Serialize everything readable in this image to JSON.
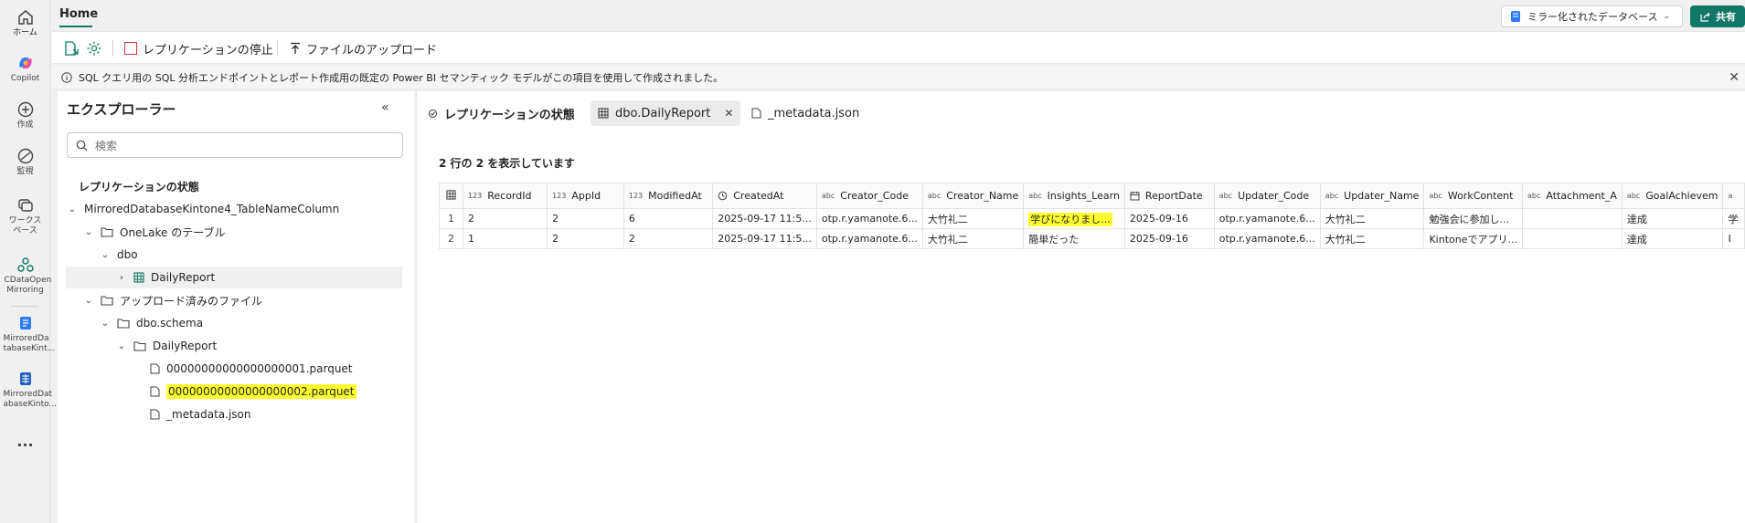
{
  "rail": {
    "items": [
      {
        "label": "ホーム",
        "icon": "home-icon"
      },
      {
        "label": "Copilot",
        "icon": "copilot-icon"
      },
      {
        "label": "作成",
        "icon": "create-icon"
      },
      {
        "label": "監視",
        "icon": "monitor-icon"
      },
      {
        "label": "ワークスペース",
        "icon": "workspaces-icon"
      },
      {
        "label": "CDataOpen Mirroring",
        "icon": "workspace-icon"
      },
      {
        "label": "MirroredDa tabaseKint...",
        "icon": "mirrored-db-icon"
      },
      {
        "label": "MirroredDat abaseKinto...",
        "icon": "sql-endpoint-icon"
      }
    ],
    "more": "..."
  },
  "topbar": {
    "home_tab": "Home",
    "mirror_dropdown": "ミラー化されたデータベース",
    "share": "共有"
  },
  "toolbar": {
    "stop_replication": "レプリケーションの停止",
    "upload_files": "ファイルのアップロード"
  },
  "infobar": {
    "message": "SQL クエリ用の SQL 分析エンドポイントとレポート作成用の既定の Power BI セマンティック モデルがこの項目を使用して作成されました。"
  },
  "explorer": {
    "title": "エクスプローラー",
    "search_placeholder": "検索",
    "tree": {
      "replication_status": "レプリケーションの状態",
      "database": "MirroredDatabaseKintone4_TableNameColumn",
      "onelake_tables": "OneLake のテーブル",
      "dbo": "dbo",
      "daily_report_table": "DailyReport",
      "uploaded_files": "アップロード済みのファイル",
      "dbo_schema": "dbo.schema",
      "daily_report_folder": "DailyReport",
      "file1": "00000000000000000001.parquet",
      "file2": "00000000000000000002.parquet",
      "file3": "_metadata.json"
    }
  },
  "content": {
    "tabs": [
      {
        "label": "レプリケーションの状態"
      },
      {
        "label": "dbo.DailyReport"
      },
      {
        "label": "_metadata.json"
      }
    ],
    "row_count": "2 行の 2 を表示しています",
    "columns": [
      {
        "type": "123",
        "name": "RecordId"
      },
      {
        "type": "123",
        "name": "AppId"
      },
      {
        "type": "123",
        "name": "ModifiedAt"
      },
      {
        "type": "clock",
        "name": "CreatedAt"
      },
      {
        "type": "abc",
        "name": "Creator_Code"
      },
      {
        "type": "abc",
        "name": "Creator_Name"
      },
      {
        "type": "abc",
        "name": "Insights_Learn"
      },
      {
        "type": "calendar",
        "name": "ReportDate"
      },
      {
        "type": "abc",
        "name": "Updater_Code"
      },
      {
        "type": "abc",
        "name": "Updater_Name"
      },
      {
        "type": "abc",
        "name": "WorkContent"
      },
      {
        "type": "abc",
        "name": "Attachment_A"
      },
      {
        "type": "abc",
        "name": "GoalAchievem"
      },
      {
        "type": "abc",
        "name": "a"
      }
    ],
    "rows": [
      {
        "idx": "1",
        "cells": [
          "2",
          "2",
          "6",
          "2025-09-17 11:5...",
          "otp.r.yamanote.6...",
          "大竹礼二",
          "学びになりまし...",
          "2025-09-16",
          "otp.r.yamanote.6...",
          "大竹礼二",
          "勉強会に参加し...",
          "",
          "達成",
          "学"
        ]
      },
      {
        "idx": "2",
        "cells": [
          "1",
          "2",
          "2",
          "2025-09-17 11:5...",
          "otp.r.yamanote.6...",
          "大竹礼二",
          "簡単だった",
          "2025-09-16",
          "otp.r.yamanote.6...",
          "大竹礼二",
          "Kintoneでアプリ...",
          "",
          "達成",
          "I"
        ]
      }
    ]
  },
  "colors": {
    "accent": "#117865",
    "highlight": "#ffff2e"
  }
}
